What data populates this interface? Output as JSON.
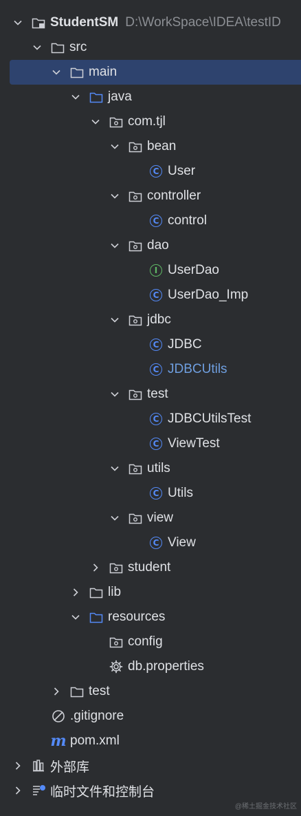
{
  "tree": {
    "root": {
      "label": "StudentSM",
      "path": "D:\\WorkSpace\\IDEA\\testID"
    },
    "src": "src",
    "main": "main",
    "java": "java",
    "com_tjl": "com.tjl",
    "bean": "bean",
    "user": "User",
    "controller": "controller",
    "control": "control",
    "dao": "dao",
    "user_dao": "UserDao",
    "user_dao_imp": "UserDao_Imp",
    "jdbc": "jdbc",
    "jdbc_class": "JDBC",
    "jdbc_utils": "JDBCUtils",
    "test_pkg": "test",
    "jdbc_utils_test": "JDBCUtilsTest",
    "view_test": "ViewTest",
    "utils": "utils",
    "utils_class": "Utils",
    "view": "view",
    "view_class": "View",
    "student": "student",
    "lib": "lib",
    "resources": "resources",
    "config": "config",
    "db_properties": "db.properties",
    "test_dir": "test",
    "gitignore": ".gitignore",
    "pom": "pom.xml",
    "external_libraries": "外部库",
    "scratches": "临时文件和控制台"
  },
  "icons": {
    "class_glyph": "C",
    "interface_glyph": "I",
    "maven_glyph": "m"
  },
  "watermark": "@稀土掘金技术社区",
  "colors": {
    "background": "#2b2d30",
    "selection": "#2e436e",
    "class_icon": "#548af7",
    "interface_icon": "#5fb865",
    "highlight_text": "#6f9fe0"
  }
}
